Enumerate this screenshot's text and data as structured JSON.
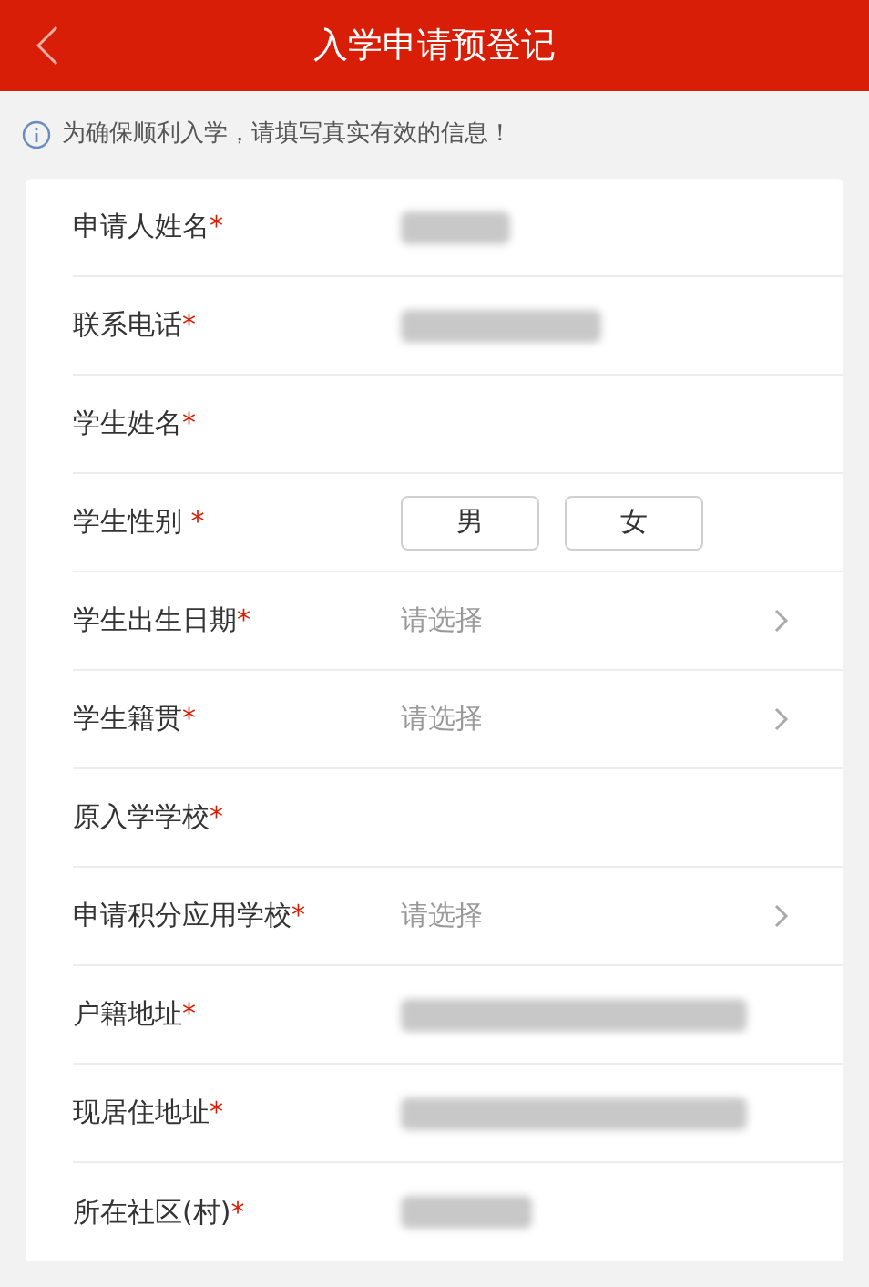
{
  "header": {
    "title": "入学申请预登记"
  },
  "notice": "为确保顺利入学，请填写真实有效的信息！",
  "fields": [
    {
      "kind": "redacted",
      "label": "申请人姓名",
      "mark": "*"
    },
    {
      "kind": "redacted",
      "label": "联系电话",
      "mark": "*"
    },
    {
      "kind": "text",
      "label": "学生姓名",
      "mark": "*"
    },
    {
      "kind": "options",
      "label": "学生性别",
      "mark": " *",
      "options": [
        {
          "label": "男",
          "selected": false
        },
        {
          "label": "女",
          "selected": false
        }
      ]
    },
    {
      "kind": "select",
      "label": "学生出生日期",
      "mark": "*",
      "placeholder": "请选择"
    },
    {
      "kind": "select",
      "label": "学生籍贯",
      "mark": "*",
      "placeholder": "请选择"
    },
    {
      "kind": "text",
      "label": "原入学学校",
      "mark": "*"
    },
    {
      "kind": "select",
      "label": "申请积分应用学校",
      "mark": "*",
      "placeholder": "请选择"
    },
    {
      "kind": "redacted",
      "label": "户籍地址",
      "mark": "*"
    },
    {
      "kind": "redacted",
      "label": "现居住地址",
      "mark": "*"
    },
    {
      "kind": "redacted",
      "label": "所在社区(村)",
      "mark": "*"
    }
  ]
}
